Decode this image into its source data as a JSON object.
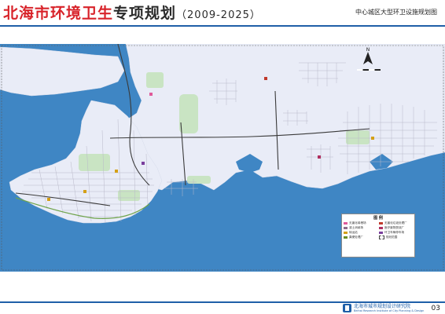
{
  "title": {
    "main": "北海市环境卫生",
    "sub": "专项规划",
    "years": "（2009-2025）"
  },
  "map_caption": "中心城区大型环卫设施规划图",
  "legend": {
    "title": "图 例",
    "items": [
      {
        "label": "无害化填埋场",
        "color": "#e05a9a"
      },
      {
        "label": "无害化垃圾处理厂",
        "color": "#c0392b"
      },
      {
        "label": "渣土消纳场",
        "color": "#8e6c8a"
      },
      {
        "label": "医疗废物焚烧厂",
        "color": "#b03060"
      },
      {
        "label": "转运站",
        "color": "#d4a017"
      },
      {
        "label": "环卫车辆停车场",
        "color": "#7a3e9d"
      },
      {
        "label": "粪便处理厂",
        "color": "#6b8e23"
      },
      {
        "label": "规划范围",
        "color": "#444444"
      }
    ]
  },
  "colors": {
    "sea": "#3f86c4",
    "land": "#e9ecf7",
    "green": "#c9e4c3",
    "road_main": "#3a3a3a",
    "road_minor": "#b9b9c9",
    "accent": "#1f5fa8",
    "title_red": "#d8232a"
  },
  "north_arrow": {
    "symbol": "N"
  },
  "footer": {
    "org_cn": "北海市城市规划设计研究院",
    "org_en": "Beihai Research Institute of City Planning & Design",
    "page_number": "03"
  }
}
